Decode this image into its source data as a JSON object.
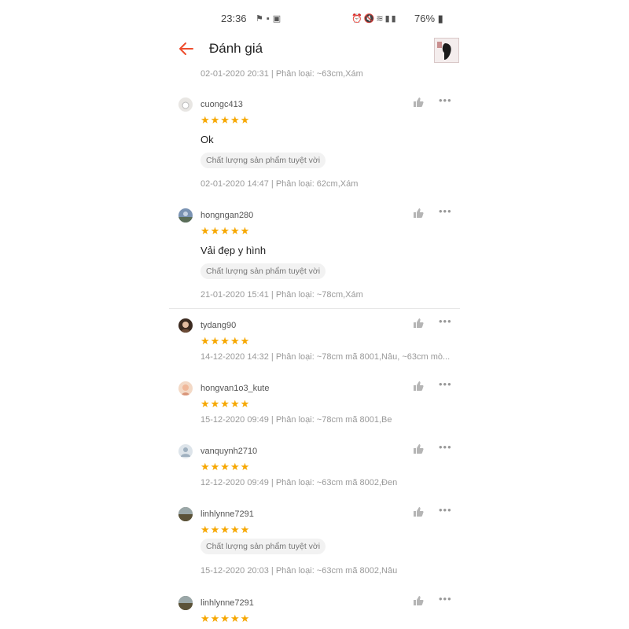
{
  "status": {
    "time": "23:36",
    "battery": "76%"
  },
  "header": {
    "title": "Đánh giá"
  },
  "top_meta": "02-01-2020 20:31 | Phân loại: ~63cm,Xám",
  "reviews": [
    {
      "user": "cuongc413",
      "rating": 5,
      "stars": "★★★★★",
      "comment": "Ok",
      "tag": "Chất lượng sản phẩm tuyệt vời",
      "meta": "02-01-2020 14:47 | Phân loại: 62cm,Xám"
    },
    {
      "user": "hongngan280",
      "rating": 5,
      "stars": "★★★★★",
      "comment": "Vải đẹp y hình",
      "tag": "Chất lượng sản phẩm tuyệt vời",
      "meta": "21-01-2020 15:41 | Phân loại: ~78cm,Xám"
    },
    {
      "user": "tydang90",
      "rating": 5,
      "stars": "★★★★★",
      "meta": "14-12-2020 14:32 | Phân loại: ~78cm mã 8001,Nâu, ~63cm mò..."
    },
    {
      "user": "hongvan1o3_kute",
      "rating": 5,
      "stars": "★★★★★",
      "meta": "15-12-2020 09:49 | Phân loại: ~78cm mã 8001,Be"
    },
    {
      "user": "vanquynh2710",
      "rating": 5,
      "stars": "★★★★★",
      "meta": "12-12-2020 09:49 | Phân loại: ~63cm mã 8002,Đen"
    },
    {
      "user": "linhlynne7291",
      "rating": 5,
      "stars": "★★★★★",
      "tag": "Chất lượng sản phẩm tuyệt vời",
      "meta": "15-12-2020 20:03 | Phân loại: ~63cm mã 8002,Nâu"
    },
    {
      "user": "linhlynne7291",
      "rating": 5,
      "stars": "★★★★★"
    }
  ],
  "icons": {
    "back": "arrow-left-icon",
    "like": "thumbs-up-icon",
    "more": "more-dots-icon"
  },
  "colors": {
    "accent": "#ee4d2d",
    "star": "#f6a700"
  }
}
